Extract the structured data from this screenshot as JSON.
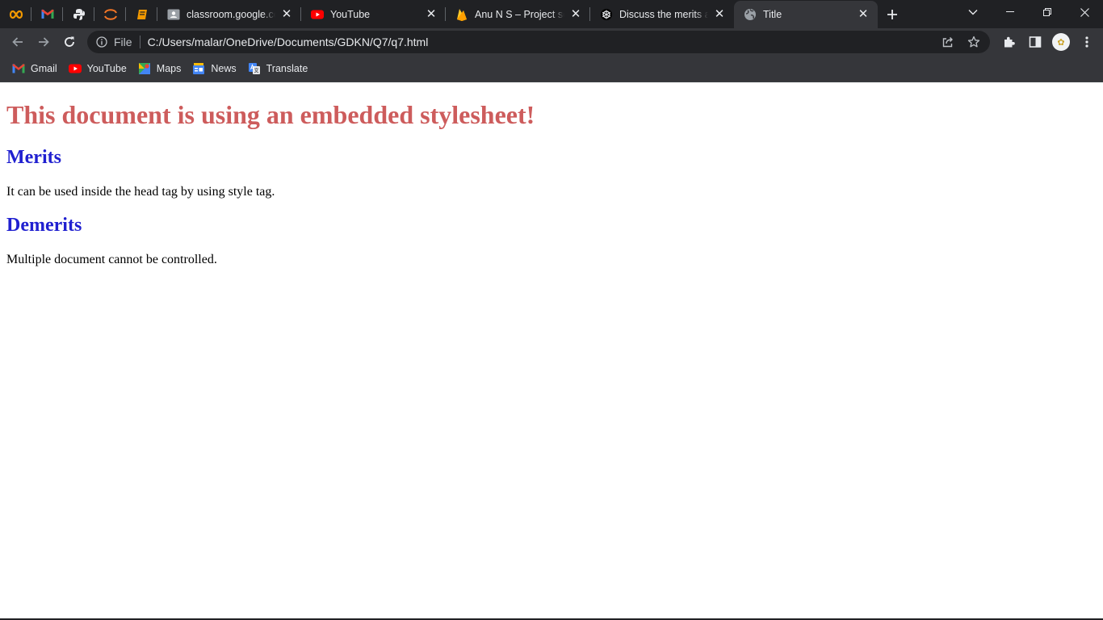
{
  "browser": {
    "pinned_tabs": [
      {
        "icon": "infinity-icon"
      },
      {
        "icon": "gmail-icon"
      },
      {
        "icon": "python-icon"
      },
      {
        "icon": "jupyter-icon"
      },
      {
        "icon": "book-icon"
      }
    ],
    "tabs": [
      {
        "title": "classroom.google.com",
        "icon": "classroom-icon"
      },
      {
        "title": "YouTube",
        "icon": "youtube-icon"
      },
      {
        "title": "Anu N S – Project settings",
        "icon": "firebase-icon"
      },
      {
        "title": "Discuss the merits and demerits",
        "icon": "openai-icon"
      },
      {
        "title": "Title",
        "icon": "globe-icon",
        "active": true
      }
    ],
    "address_bar": {
      "scheme_label": "File",
      "url": "C:/Users/malar/OneDrive/Documents/GDKN/Q7/q7.html"
    },
    "bookmarks": [
      {
        "label": "Gmail",
        "icon": "gmail-icon"
      },
      {
        "label": "YouTube",
        "icon": "youtube-icon"
      },
      {
        "label": "Maps",
        "icon": "maps-icon"
      },
      {
        "label": "News",
        "icon": "news-icon"
      },
      {
        "label": "Translate",
        "icon": "translate-icon"
      }
    ]
  },
  "page": {
    "heading": "This document is using an embedded stylesheet!",
    "sections": [
      {
        "title": "Merits",
        "text": "It can be used inside the head tag by using style tag."
      },
      {
        "title": "Demerits",
        "text": "Multiple document cannot be controlled."
      }
    ]
  },
  "colors": {
    "h1": "#cd5c5c",
    "h2": "#2020d0",
    "chrome_dark": "#202124",
    "chrome_toolbar": "#35363a"
  }
}
